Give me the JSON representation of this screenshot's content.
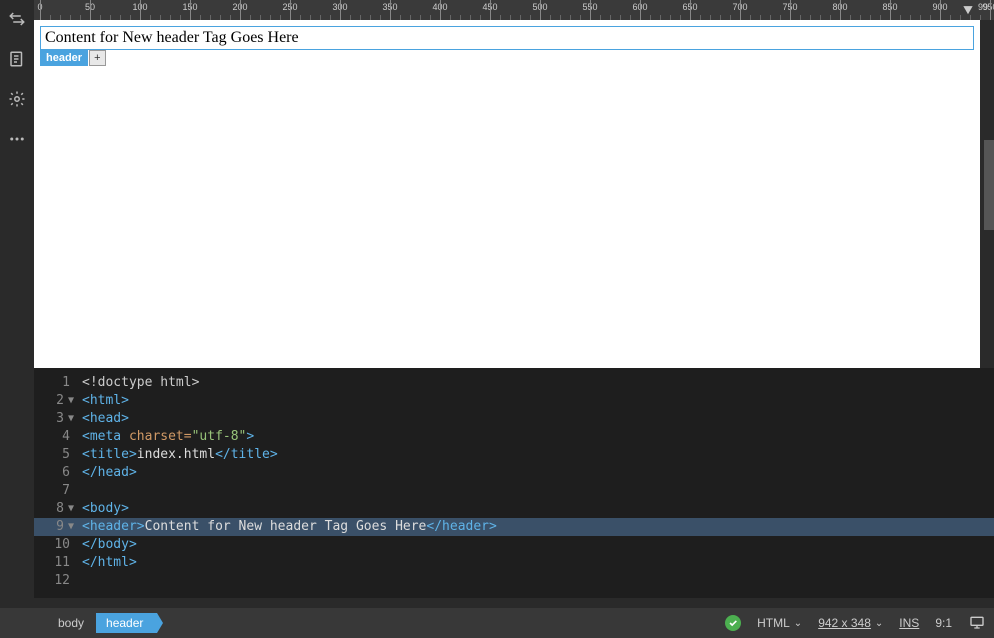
{
  "ruler": {
    "max": 950,
    "step_major": 50,
    "step_minor": 10,
    "top_right_label": "99"
  },
  "preview": {
    "header_text": "Content for New header Tag Goes Here",
    "tag_badge": "header",
    "tag_plus": "+"
  },
  "code": {
    "lines": [
      {
        "n": 1,
        "fold": "",
        "tokens": [
          [
            "doctype",
            "<!doctype html>"
          ]
        ]
      },
      {
        "n": 2,
        "fold": "▼",
        "tokens": [
          [
            "tag",
            "<html>"
          ]
        ]
      },
      {
        "n": 3,
        "fold": "▼",
        "tokens": [
          [
            "tag",
            "<head>"
          ]
        ]
      },
      {
        "n": 4,
        "fold": "",
        "tokens": [
          [
            "tag",
            "<meta "
          ],
          [
            "attr",
            "charset="
          ],
          [
            "str",
            "\"utf-8\""
          ],
          [
            "tag",
            ">"
          ]
        ]
      },
      {
        "n": 5,
        "fold": "",
        "tokens": [
          [
            "tag",
            "<title>"
          ],
          [
            "text",
            "index.html"
          ],
          [
            "tag",
            "</title>"
          ]
        ]
      },
      {
        "n": 6,
        "fold": "",
        "tokens": [
          [
            "tag",
            "</head>"
          ]
        ]
      },
      {
        "n": 7,
        "fold": "",
        "tokens": []
      },
      {
        "n": 8,
        "fold": "▼",
        "tokens": [
          [
            "tag",
            "<body>"
          ]
        ]
      },
      {
        "n": 9,
        "fold": "▼",
        "selected": true,
        "tokens": [
          [
            "tag",
            "<header>"
          ],
          [
            "text",
            "Content for New header Tag Goes Here"
          ],
          [
            "tag",
            "</header>"
          ]
        ]
      },
      {
        "n": 10,
        "fold": "",
        "tokens": [
          [
            "tag",
            "</body>"
          ]
        ]
      },
      {
        "n": 11,
        "fold": "",
        "tokens": [
          [
            "tag",
            "</html>"
          ]
        ]
      },
      {
        "n": 12,
        "fold": "",
        "tokens": []
      }
    ]
  },
  "breadcrumb": {
    "items": [
      "body",
      "header"
    ],
    "active_index": 1
  },
  "status": {
    "lang": "HTML",
    "dimensions": "942 x 348",
    "dim_arrow": "⌄",
    "insert_mode": "INS",
    "cursor_pos": "9:1"
  }
}
